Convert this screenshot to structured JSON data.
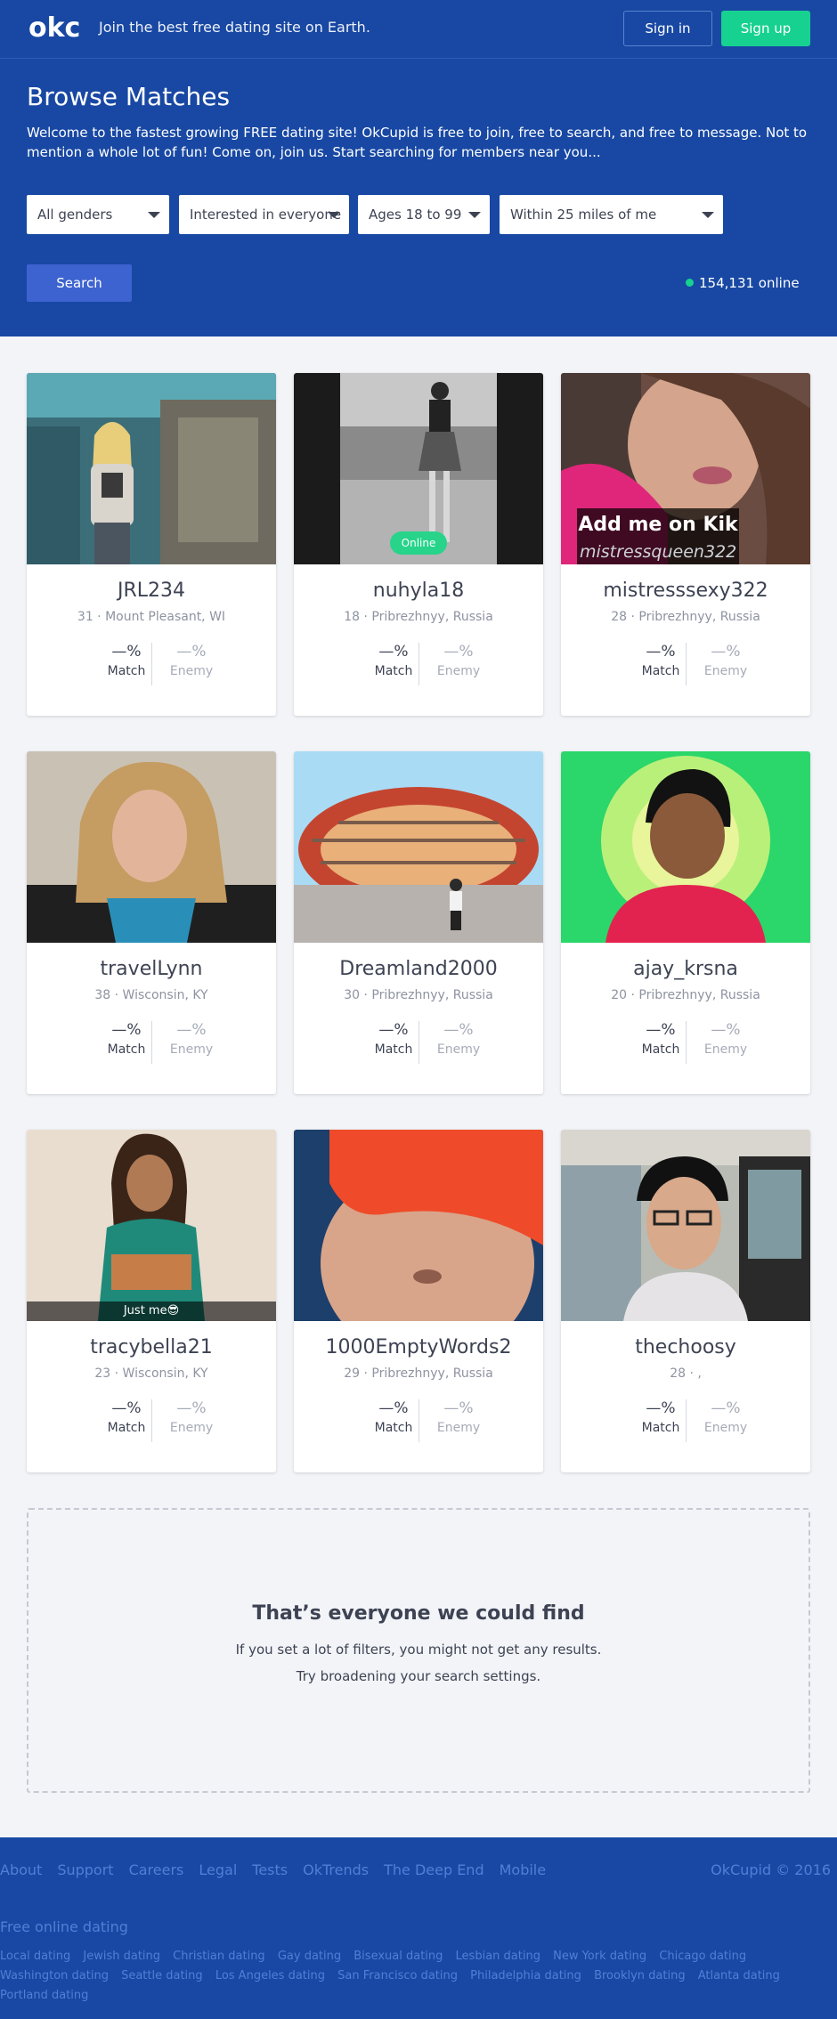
{
  "header": {
    "logo_text": "okc",
    "tagline": "Join the best free dating site on Earth.",
    "signin_label": "Sign in",
    "signup_label": "Sign up"
  },
  "hero": {
    "title": "Browse Matches",
    "description": "Welcome to the fastest growing FREE dating site! OkCupid is free to join, free to search, and free to message. Not to mention a whole lot of fun! Come on, join us. Start searching for members near you...",
    "filters": {
      "gender": "All genders",
      "interest": "Interested in everyone",
      "ages": "Ages 18 to 99",
      "distance": "Within 25 miles of me"
    },
    "search_label": "Search",
    "online_count": "154,131 online"
  },
  "profiles": [
    {
      "username": "JRL234",
      "location": "31 · Mount Pleasant, WI",
      "match": "—%",
      "match_label": "Match",
      "enemy": "—%",
      "enemy_label": "Enemy"
    },
    {
      "username": "nuhyla18",
      "location": "18 · Pribrezhnyy, Russia",
      "match": "—%",
      "match_label": "Match",
      "enemy": "—%",
      "enemy_label": "Enemy",
      "badge": "Online"
    },
    {
      "username": "mistresssexy322",
      "location": "28 · Pribrezhnyy, Russia",
      "match": "—%",
      "match_label": "Match",
      "enemy": "—%",
      "enemy_label": "Enemy",
      "photo_caption": "Add me on Kik",
      "photo_caption2": "mistressqueen322"
    },
    {
      "username": "travelLynn",
      "location": "38 · Wisconsin, KY",
      "match": "—%",
      "match_label": "Match",
      "enemy": "—%",
      "enemy_label": "Enemy"
    },
    {
      "username": "Dreamland2000",
      "location": "30 · Pribrezhnyy, Russia",
      "match": "—%",
      "match_label": "Match",
      "enemy": "—%",
      "enemy_label": "Enemy"
    },
    {
      "username": "ajay_krsna",
      "location": "20 · Pribrezhnyy, Russia",
      "match": "—%",
      "match_label": "Match",
      "enemy": "—%",
      "enemy_label": "Enemy"
    },
    {
      "username": "tracybella21",
      "location": "23 · Wisconsin, KY",
      "match": "—%",
      "match_label": "Match",
      "enemy": "—%",
      "enemy_label": "Enemy",
      "photo_caption": "Just me😎"
    },
    {
      "username": "1000EmptyWords2",
      "location": "29 · Pribrezhnyy, Russia",
      "match": "—%",
      "match_label": "Match",
      "enemy": "—%",
      "enemy_label": "Enemy"
    },
    {
      "username": "thechoosy",
      "location": "28 · ,",
      "match": "—%",
      "match_label": "Match",
      "enemy": "—%",
      "enemy_label": "Enemy"
    }
  ],
  "empty_state": {
    "title": "That’s everyone we could find",
    "line1": "If you set a lot of filters, you might not get any results.",
    "line2": "Try broadening your search settings."
  },
  "footer": {
    "links": [
      "About",
      "Support",
      "Careers",
      "Legal",
      "Tests",
      "OkTrends",
      "The Deep End",
      "Mobile"
    ],
    "copyright": "OkCupid © 2016",
    "free_online_dating": "Free online dating",
    "cities": [
      "Local dating",
      "Jewish dating",
      "Christian dating",
      "Gay dating",
      "Bisexual dating",
      "Lesbian dating",
      "New York dating",
      "Chicago dating",
      "Washington dating",
      "Seattle dating",
      "Los Angeles dating",
      "San Francisco dating",
      "Philadelphia dating",
      "Brooklyn dating",
      "Atlanta dating",
      "Portland dating"
    ]
  },
  "colors": {
    "brand_blue": "#1848a3",
    "signup_green": "#17d190",
    "search_button": "#3d63d1",
    "online_green": "#27d48a"
  }
}
